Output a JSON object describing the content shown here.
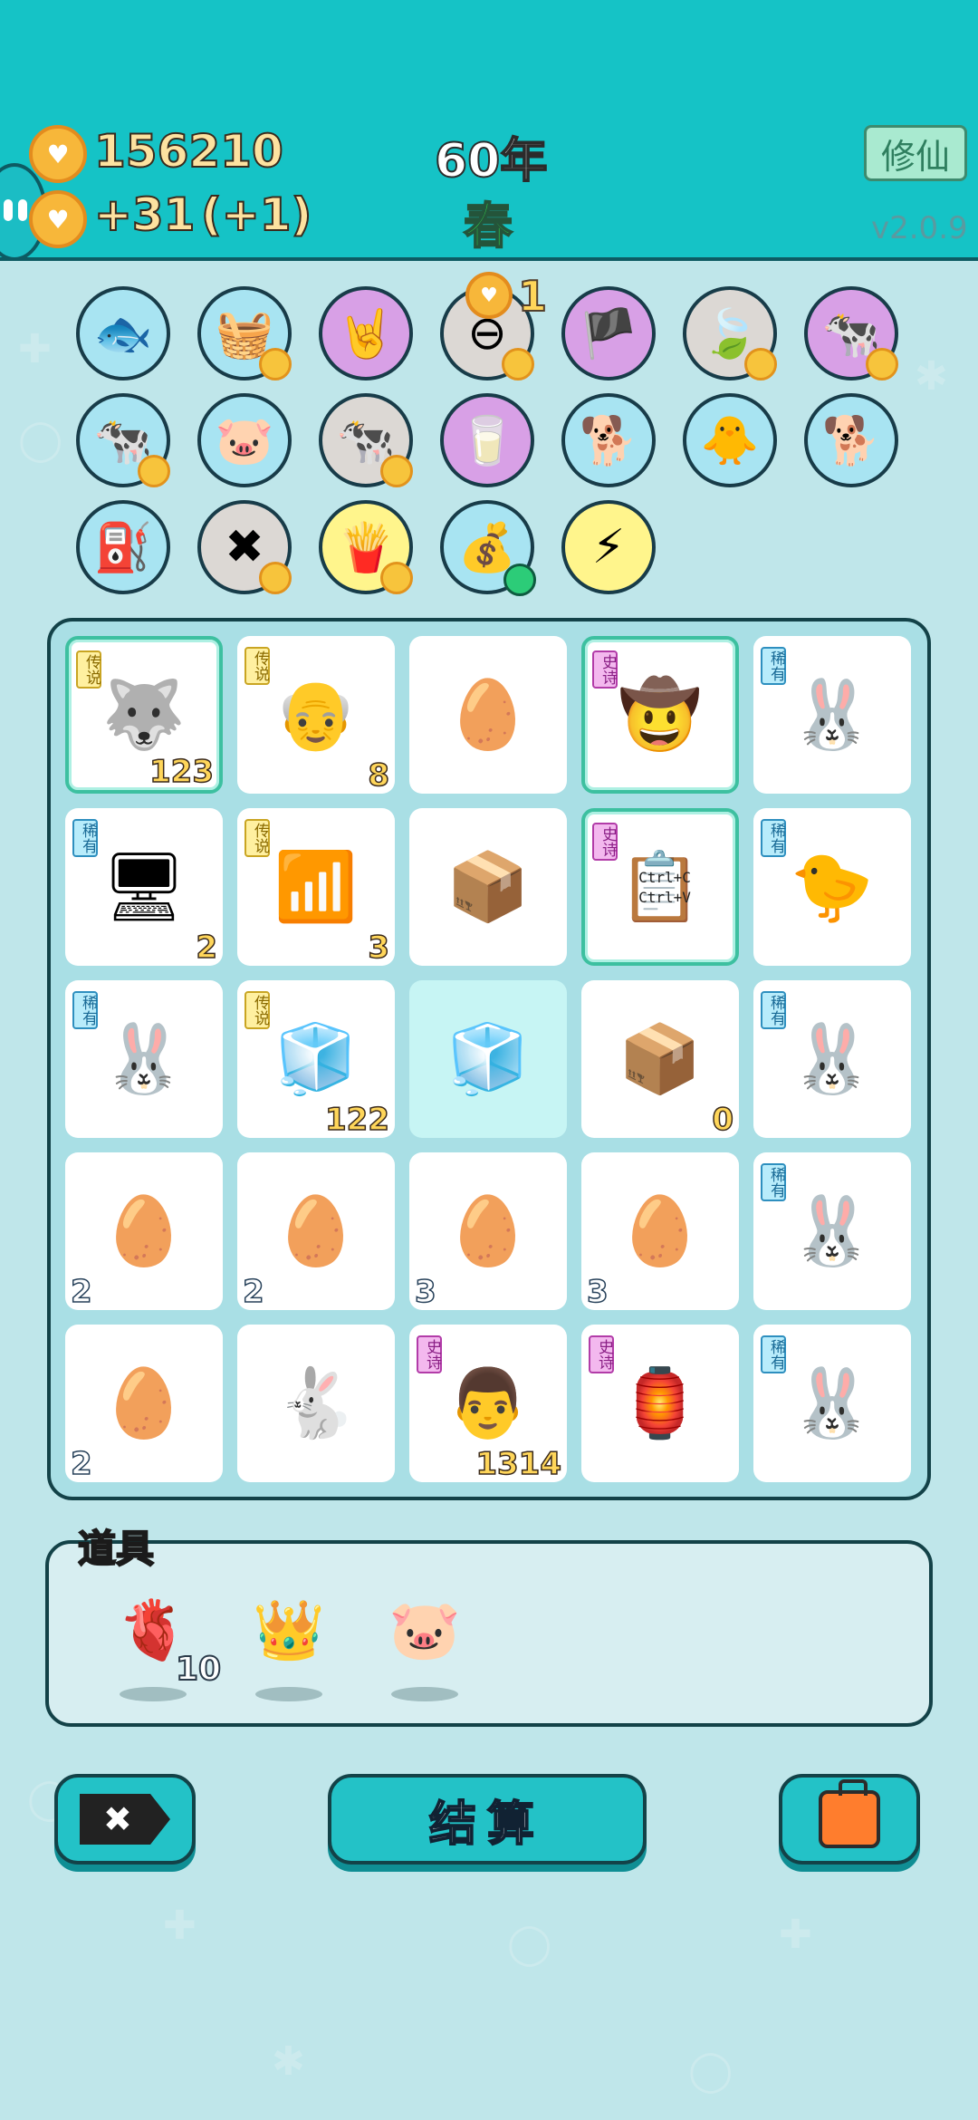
{
  "header": {
    "coins": "156210",
    "income": "+31",
    "income_bonus": "(+1)",
    "year": "60年",
    "season": "春",
    "xiuxian_button": "修仙",
    "version": "v2.0.9"
  },
  "relics": {
    "plus_indicator": "1",
    "items": [
      {
        "name": "fish-tank-icon",
        "glyph": "🐟",
        "bg": "blue",
        "badge": false
      },
      {
        "name": "fruit-basket-icon",
        "glyph": "🧺",
        "bg": "blue",
        "badge": true
      },
      {
        "name": "rock-hand-icon",
        "glyph": "🤘",
        "bg": "purple",
        "badge": false
      },
      {
        "name": "no-entry-icon",
        "glyph": "⊖",
        "bg": "gray",
        "badge": true
      },
      {
        "name": "eyepatch-icon",
        "glyph": "🏴",
        "bg": "purple",
        "badge": false
      },
      {
        "name": "leaf-icon",
        "glyph": "🍃",
        "bg": "gray",
        "badge": true
      },
      {
        "name": "cow-pair-icon",
        "glyph": "🐄",
        "bg": "purple",
        "badge": true
      },
      {
        "name": "cow-pair-icon",
        "glyph": "🐄",
        "bg": "blue",
        "badge": true
      },
      {
        "name": "piggy-bank-icon",
        "glyph": "🐷",
        "bg": "blue",
        "badge": false
      },
      {
        "name": "cow-pair-icon",
        "glyph": "🐄",
        "bg": "gray",
        "badge": true
      },
      {
        "name": "milk-jar-icon",
        "glyph": "🥛",
        "bg": "purple",
        "badge": false
      },
      {
        "name": "cool-dog-icon",
        "glyph": "🐕",
        "bg": "blue",
        "badge": false
      },
      {
        "name": "chick-egg-icon",
        "glyph": "🐥",
        "bg": "blue",
        "badge": false
      },
      {
        "name": "cool-dog-icon",
        "glyph": "🐕",
        "bg": "blue",
        "badge": false
      },
      {
        "name": "pump-icon",
        "glyph": "⛽",
        "bg": "blue",
        "badge": false
      },
      {
        "name": "delete-tag-icon",
        "glyph": "✖",
        "bg": "gray",
        "badge": true
      },
      {
        "name": "fries-icon",
        "glyph": "🍟",
        "bg": "yellow",
        "badge": true
      },
      {
        "name": "sack-icon",
        "glyph": "💰",
        "bg": "blue",
        "badge": false
      },
      {
        "name": "lightning-icon",
        "glyph": "⚡",
        "bg": "yellow",
        "badge": false
      }
    ]
  },
  "board": {
    "cells": [
      {
        "name": "husky-king-icon",
        "glyph": "🐺",
        "tag": "传说",
        "tagType": "leg",
        "count": "123",
        "hl": true
      },
      {
        "name": "old-man-glasses-icon",
        "glyph": "👴",
        "tag": "传说",
        "tagType": "leg",
        "count": "8"
      },
      {
        "name": "egg-icon",
        "glyph": "🥚"
      },
      {
        "name": "farmer-icon",
        "glyph": "🤠",
        "tag": "史诗",
        "tagType": "epic",
        "hl": true
      },
      {
        "name": "rabbit-icon",
        "glyph": "🐰",
        "tag": "稀有",
        "tagType": "rare"
      },
      {
        "name": "cpu-icon",
        "glyph": "🖥",
        "tag": "稀有",
        "tagType": "rare",
        "count": "2"
      },
      {
        "name": "wifi-icon",
        "glyph": "📶",
        "tag": "传说",
        "tagType": "leg",
        "count": "3"
      },
      {
        "name": "package-icon",
        "glyph": "📦"
      },
      {
        "name": "copy-paste-icon",
        "glyph": "📋",
        "tag": "史诗",
        "tagType": "epic",
        "hl": true,
        "caption": "Ctrl+C Ctrl+V"
      },
      {
        "name": "chick-icon",
        "glyph": "🐤",
        "tag": "稀有",
        "tagType": "rare"
      },
      {
        "name": "rabbit-icon",
        "glyph": "🐰",
        "tag": "稀有",
        "tagType": "rare"
      },
      {
        "name": "fridge-icon",
        "glyph": "🧊",
        "tag": "传说",
        "tagType": "leg",
        "count": "122"
      },
      {
        "name": "fridge-icon",
        "glyph": "🧊",
        "glow": true
      },
      {
        "name": "package-icon",
        "glyph": "📦",
        "count": "0"
      },
      {
        "name": "rabbit-icon",
        "glyph": "🐰",
        "tag": "稀有",
        "tagType": "rare"
      },
      {
        "name": "egg-icon",
        "glyph": "🥚",
        "countLeft": "2"
      },
      {
        "name": "egg-icon",
        "glyph": "🥚",
        "countLeft": "2"
      },
      {
        "name": "egg-icon",
        "glyph": "🥚",
        "countLeft": "3"
      },
      {
        "name": "egg-icon",
        "glyph": "🥚",
        "countLeft": "3"
      },
      {
        "name": "rabbit-icon",
        "glyph": "🐰",
        "tag": "稀有",
        "tagType": "rare"
      },
      {
        "name": "egg-icon",
        "glyph": "🥚",
        "countLeft": "2"
      },
      {
        "name": "rabbit-icon",
        "glyph": "🐇"
      },
      {
        "name": "grumpy-man-icon",
        "glyph": "👨",
        "tag": "史诗",
        "tagType": "epic",
        "count": "1314"
      },
      {
        "name": "rabbit-house-icon",
        "glyph": "🏮",
        "tag": "史诗",
        "tagType": "epic"
      },
      {
        "name": "rabbit-icon",
        "glyph": "🐰",
        "tag": "稀有",
        "tagType": "rare"
      }
    ]
  },
  "props": {
    "title": "道具",
    "liver_count": "10",
    "items": [
      {
        "name": "liver-icon",
        "glyph": "🫀"
      },
      {
        "name": "crown-icon",
        "glyph": "👑"
      },
      {
        "name": "piggy-bank-icon",
        "glyph": "🐷"
      }
    ]
  },
  "buttons": {
    "settle_label": "结算"
  }
}
